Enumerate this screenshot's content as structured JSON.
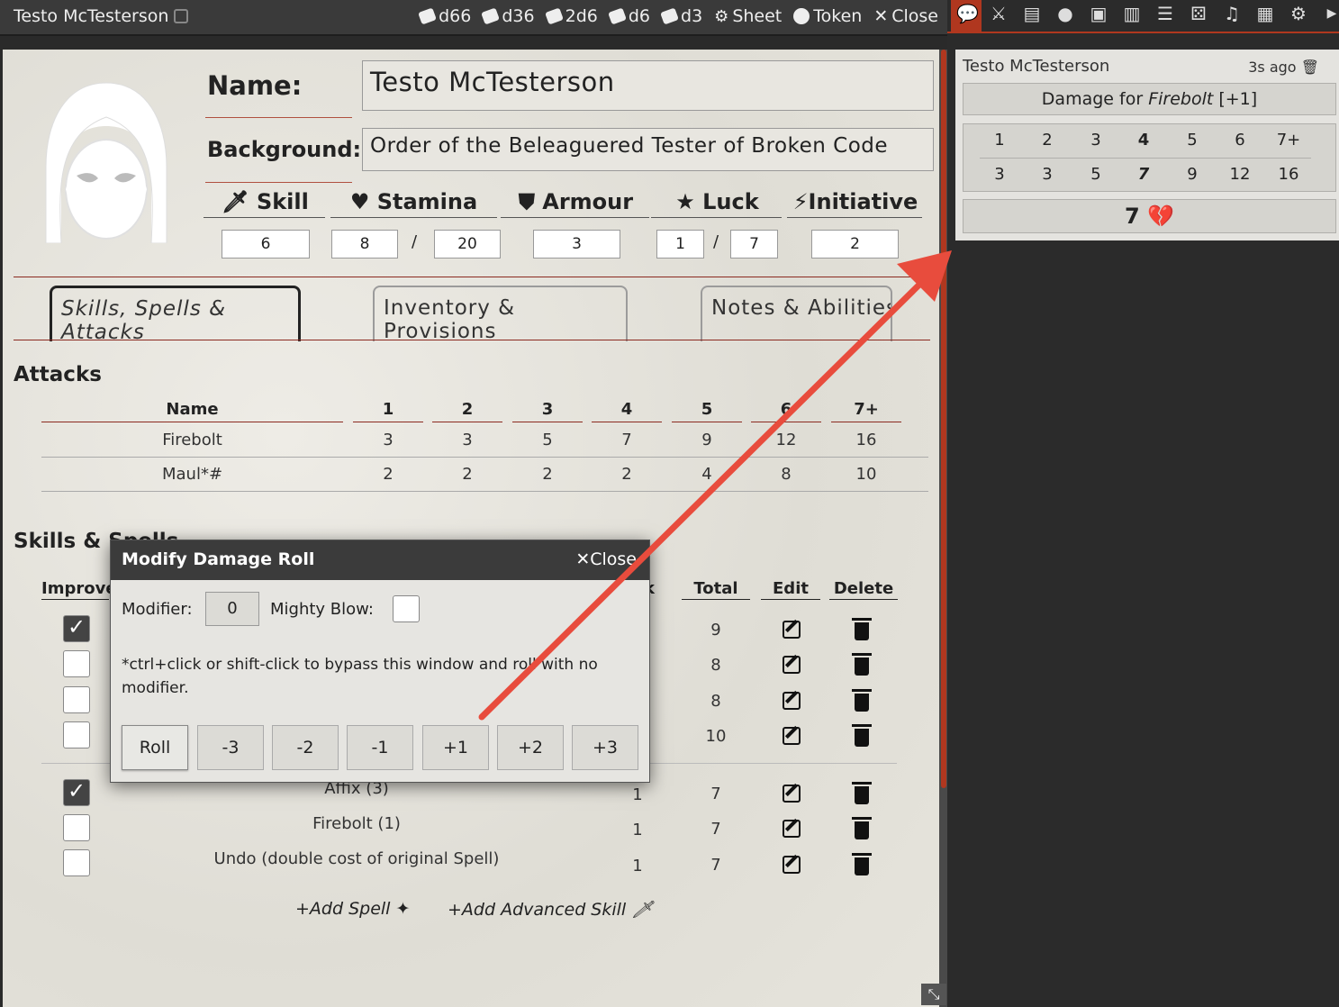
{
  "topbar": {
    "title": "Testo McTesterson",
    "buttons": [
      "d66",
      "d36",
      "2d6",
      "d6",
      "d3",
      "Sheet",
      "Token",
      "Close"
    ]
  },
  "sheet": {
    "name_label": "Name:",
    "name_value": "Testo McTesterson",
    "background_label": "Background:",
    "background_value": "Order of the Beleaguered Tester of Broken Code",
    "stats": {
      "skill_label": "Skill",
      "skill": "6",
      "stamina_label": "Stamina",
      "stamina": "8",
      "stamina_max": "20",
      "armour_label": "Armour",
      "armour": "3",
      "luck_label": "Luck",
      "luck": "1",
      "luck_max": "7",
      "initiative_label": "Initiative",
      "initiative": "2",
      "slash": "/"
    },
    "tabs": [
      "Skills, Spells & Attacks",
      "Inventory & Provisions",
      "Notes & Abilities"
    ],
    "attacks": {
      "heading": "Attacks",
      "columns": [
        "Name",
        "1",
        "2",
        "3",
        "4",
        "5",
        "6",
        "7+"
      ],
      "rows": [
        [
          "Firebolt",
          "3",
          "3",
          "5",
          "7",
          "9",
          "12",
          "16"
        ],
        [
          "Maul*#",
          "2",
          "2",
          "2",
          "2",
          "4",
          "8",
          "10"
        ]
      ]
    },
    "skills": {
      "heading": "Skills & Spells",
      "columns": [
        "Improve",
        "k",
        "Total",
        "Edit",
        "Delete"
      ],
      "totals": [
        "9",
        "8",
        "8",
        "10"
      ],
      "spells": [
        {
          "name": "Affix (3)",
          "rank": "1",
          "total": "7"
        },
        {
          "name": "Firebolt (1)",
          "rank": "1",
          "total": "7"
        },
        {
          "name": "Undo (double cost of original Spell)",
          "rank": "1",
          "total": "7"
        }
      ],
      "add_spell": "+Add Spell",
      "add_advanced": "+Add Advanced Skill"
    }
  },
  "dialog": {
    "title": "Modify Damage Roll",
    "close_label": "✕Close",
    "modifier_label": "Modifier:",
    "modifier_value": "0",
    "mighty_blow_label": "Mighty Blow:",
    "hint": "*ctrl+click or shift-click to bypass this window and roll with no modifier.",
    "buttons": [
      "Roll",
      "-3",
      "-2",
      "-1",
      "+1",
      "+2",
      "+3"
    ]
  },
  "chat": {
    "who": "Testo McTesterson",
    "ago": "3s ago",
    "title_prefix": "Damage for ",
    "title_item": "Firebolt",
    "title_suffix": " [+1]",
    "rolls": [
      "1",
      "2",
      "3",
      "4",
      "5",
      "6",
      "7+"
    ],
    "damage": [
      "3",
      "3",
      "5",
      "7",
      "9",
      "12",
      "16"
    ],
    "result": "7"
  }
}
